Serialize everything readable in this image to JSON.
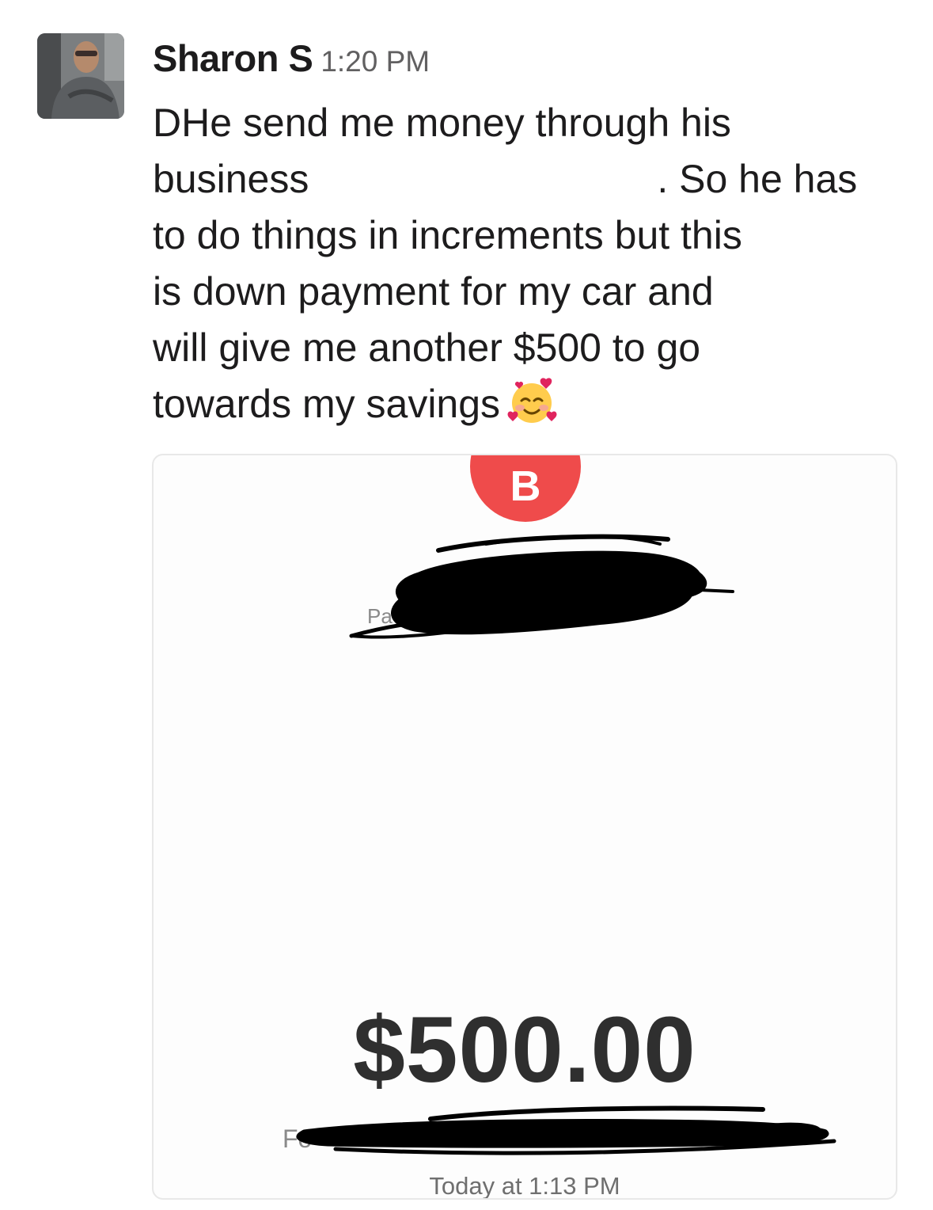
{
  "message": {
    "sender": "Sharon S",
    "time": "1:20 PM",
    "lines": [
      "DHe send me money through his",
      "business",
      ". So he has",
      "to do things in increments but this",
      "is down payment for my car and",
      "will give me another $500 to go",
      "towards my savings"
    ],
    "emoji": "smiling-face-with-hearts-icon"
  },
  "attachment": {
    "badge_letter": "B",
    "payment_label": "Pay",
    "amount": "$500.00",
    "for_label": "Fo",
    "date": "Today at 1:13 PM"
  },
  "colors": {
    "badge": "#ef4b4b",
    "amount_text": "#2f2f2f",
    "timestamp": "#616061"
  }
}
